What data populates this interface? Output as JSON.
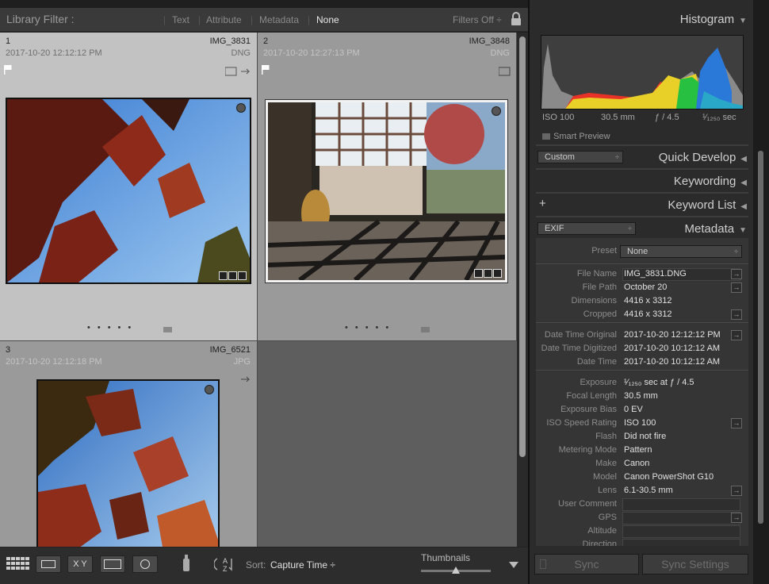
{
  "filter_bar": {
    "label": "Library Filter :",
    "tabs": [
      "Text",
      "Attribute",
      "Metadata",
      "None"
    ],
    "active_tab": "None",
    "filters_off": "Filters Off ÷"
  },
  "cells": [
    {
      "index": "1",
      "name": "IMG_3831",
      "date": "2017-10-20 12:12:12 PM",
      "ext": "DNG",
      "selected": true
    },
    {
      "index": "2",
      "name": "IMG_3848",
      "date": "2017-10-20 12:27:13 PM",
      "ext": "DNG",
      "selected": false
    },
    {
      "index": "3",
      "name": "IMG_6521",
      "date": "2017-10-20 12:12:18 PM",
      "ext": "JPG",
      "selected": false
    }
  ],
  "toolbar": {
    "sort_label": "Sort:",
    "sort_value": "Capture Time ÷",
    "thumbnails_label": "Thumbnails",
    "thumbnail_size": 0.5,
    "xy_label": "X Y"
  },
  "right_panel": {
    "histogram": {
      "title": "Histogram",
      "iso": "ISO 100",
      "focal": "30.5 mm",
      "aperture": "ƒ / 4.5",
      "shutter": "¹⁄₁₂₅₀ sec",
      "smart_preview": "Smart Preview"
    },
    "quick_develop": {
      "title": "Quick Develop",
      "preset": "Custom"
    },
    "keywording": {
      "title": "Keywording"
    },
    "keyword_list": {
      "title": "Keyword List",
      "add": "+"
    },
    "metadata": {
      "title": "Metadata",
      "preset_dropdown": "EXIF",
      "preset_label": "Preset",
      "preset_value": "None",
      "fields": [
        {
          "k": "File Name",
          "v": "IMG_3831.DNG"
        },
        {
          "k": "File Path",
          "v": "October 20"
        },
        {
          "k": "Dimensions",
          "v": "4416 x 3312"
        },
        {
          "k": "Cropped",
          "v": "4416 x 3312"
        },
        {
          "k": "Date Time Original",
          "v": "2017-10-20 12:12:12 PM"
        },
        {
          "k": "Date Time Digitized",
          "v": "2017-10-20 10:12:12 AM"
        },
        {
          "k": "Date Time",
          "v": "2017-10-20 10:12:12 AM"
        },
        {
          "k": "Exposure",
          "v": "¹⁄₁₂₅₀ sec at ƒ / 4.5"
        },
        {
          "k": "Focal Length",
          "v": "30.5 mm"
        },
        {
          "k": "Exposure Bias",
          "v": "0 EV"
        },
        {
          "k": "ISO Speed Rating",
          "v": "ISO 100"
        },
        {
          "k": "Flash",
          "v": "Did not fire"
        },
        {
          "k": "Metering Mode",
          "v": "Pattern"
        },
        {
          "k": "Make",
          "v": "Canon"
        },
        {
          "k": "Model",
          "v": "Canon PowerShot G10"
        },
        {
          "k": "Lens",
          "v": "6.1-30.5 mm"
        },
        {
          "k": "User Comment",
          "v": ""
        },
        {
          "k": "GPS",
          "v": ""
        },
        {
          "k": "Altitude",
          "v": ""
        },
        {
          "k": "Direction",
          "v": ""
        }
      ]
    },
    "sync": "Sync",
    "sync_settings": "Sync Settings"
  },
  "colors": {
    "accent": "#e8e8e8",
    "panel": "#2b2b2b",
    "grid": "#606060",
    "selected_cell": "#c2c2c2"
  }
}
